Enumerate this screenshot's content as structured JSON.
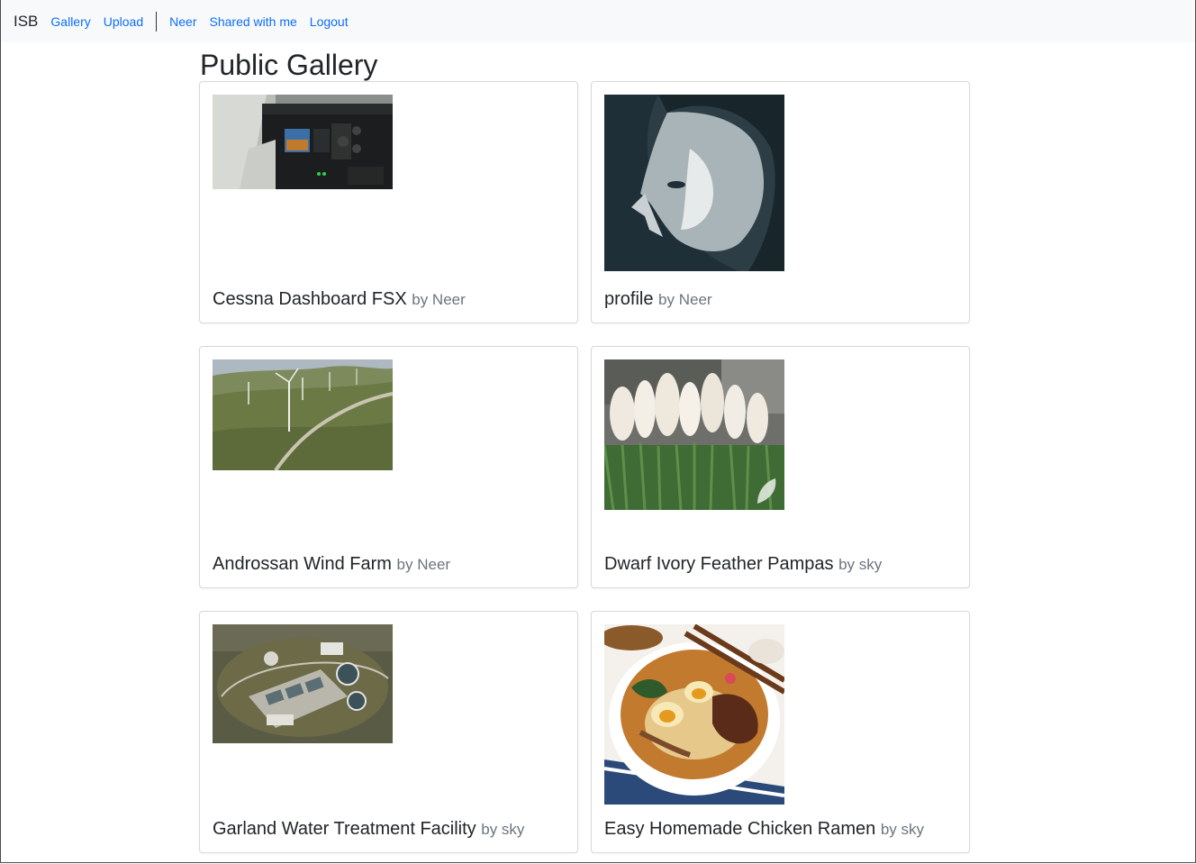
{
  "navbar": {
    "brand": "ISB",
    "links": [
      "Gallery",
      "Upload"
    ],
    "user_links": [
      "Neer",
      "Shared with me",
      "Logout"
    ]
  },
  "page": {
    "title": "Public Gallery"
  },
  "gallery": [
    {
      "title": "Cessna Dashboard FSX",
      "by": "by Neer"
    },
    {
      "title": "profile",
      "by": "by Neer"
    },
    {
      "title": "Androssan Wind Farm",
      "by": "by Neer"
    },
    {
      "title": "Dwarf Ivory Feather Pampas",
      "by": "by sky"
    },
    {
      "title": "Garland Water Treatment Facility",
      "by": "by sky"
    },
    {
      "title": "Easy Homemade Chicken Ramen",
      "by": "by sky"
    }
  ]
}
